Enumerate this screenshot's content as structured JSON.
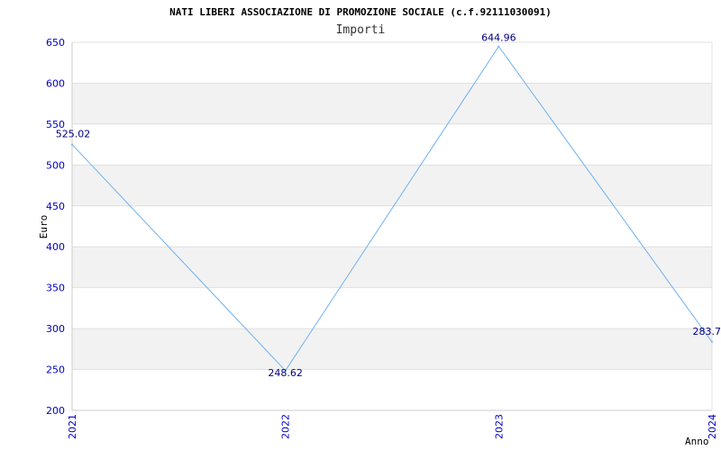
{
  "chart_data": {
    "type": "line",
    "title": "NATI LIBERI ASSOCIAZIONE DI PROMOZIONE SOCIALE (c.f.92111030091)",
    "subtitle": "Importi",
    "xlabel": "Anno",
    "ylabel": "Euro",
    "categories": [
      "2021",
      "2022",
      "2023",
      "2024"
    ],
    "series": [
      {
        "values": [
          525.02,
          248.62,
          644.96,
          283.7
        ],
        "labels": [
          "525.02",
          "248.62",
          "644.96",
          "283.7"
        ]
      }
    ],
    "ylim": [
      200,
      650
    ],
    "yticks": [
      "200",
      "250",
      "300",
      "350",
      "400",
      "450",
      "500",
      "550",
      "600",
      "650"
    ],
    "grid": true,
    "colors": {
      "line": "#6fb1f0",
      "tick_text": "#0000cc",
      "data_label": "#000080",
      "band": "#f2f2f2",
      "gridline": "#e0e0e0",
      "axis": "#cccccc"
    }
  }
}
